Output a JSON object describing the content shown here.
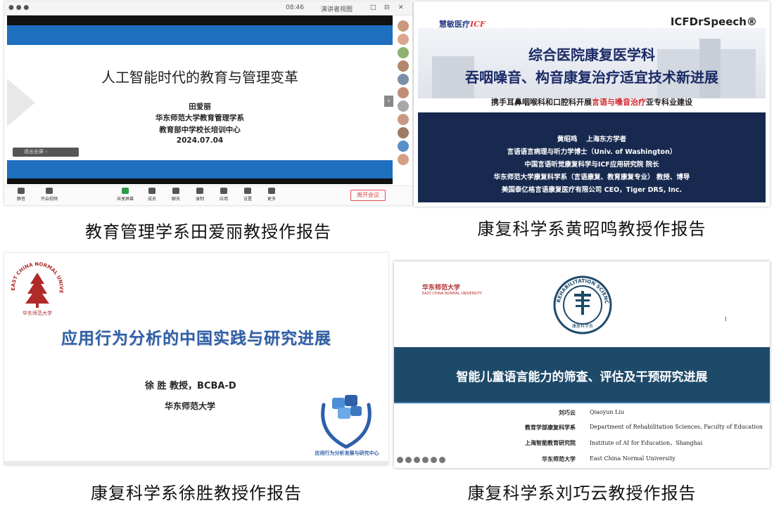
{
  "panel1": {
    "topbar": {
      "time": "08:46",
      "status": "演讲者视图",
      "items": [
        "□",
        "⊟",
        "✕"
      ]
    },
    "slide": {
      "title": "人工智能时代的教育与管理变革",
      "speaker": "田爱丽",
      "dept": "华东师范大学教育管理学系",
      "center": "教育部中学校长培训中心",
      "date": "2024.07.04"
    },
    "mini_control": "退出全屏",
    "toolbar": {
      "items": [
        "静音",
        "开启视频",
        "共享屏幕",
        "成员",
        "聊天",
        "录制",
        "应用",
        "设置",
        "更多"
      ],
      "leave": "离开会议"
    },
    "caption": "教育管理学系田爱丽教授作报告"
  },
  "panel2": {
    "logo_left_main": "慧敏医疗",
    "logo_left_icf": "ICF",
    "logo_right": "ICFDrSpeech®",
    "title1": "综合医院康复医学科",
    "title2": "吞咽噪音、构音康复治疗适宜技术新进展",
    "subtitle_a": "携手耳鼻咽喉科和口腔科开展",
    "subtitle_red": "言语与嗓音治疗",
    "subtitle_b": "亚专科业建设",
    "lines": [
      "黄昭鸣　 上海东方学者",
      "言语语言病理与听力学博士（Univ. of Washington）",
      "中国言语听觉康复科学与ICF应用研究院  院长",
      "华东师范大学康复科学系（言语康复、教育康复专业）  教授、博导",
      "美国泰亿格言语康复医疗有限公司 CEO，Tiger DRS, Inc."
    ],
    "caption": "康复科学系黄昭鸣教授作报告"
  },
  "panel3": {
    "seal_text": "EAST CHINA NORMAL UNIVERSITY",
    "seal_cn": "华东师范大学",
    "title": "应用行为分析的中国实践与研究进展",
    "speaker": "徐 胜  教授，BCBA-D",
    "univ": "华东师范大学",
    "center": "应用行为分析发展与研究中心",
    "caption": "康复科学系徐胜教授作报告"
  },
  "panel4": {
    "uni_cn": "华东师范大学",
    "uni_en": "EAST CHINA NORMAL UNIVERSITY",
    "emblem_text": "REHABILITATION SCIENCES",
    "emblem_cn": "康复科学系",
    "title": "智能儿童语言能力的筛查、评估及干预研究进展",
    "rows": [
      {
        "cn": "刘巧云",
        "en": "Qiaoyun Liu"
      },
      {
        "cn": "教育学部康复科学系",
        "en": "Department of Rehabilitation Sciences,   Faculty of Education"
      },
      {
        "cn": "上海智能教育研究院",
        "en": "Institute of AI for Education，Shanghai"
      },
      {
        "cn": "华东师范大学",
        "en": "East China Normal University"
      }
    ],
    "caption": "康复科学系刘巧云教授作报告"
  }
}
